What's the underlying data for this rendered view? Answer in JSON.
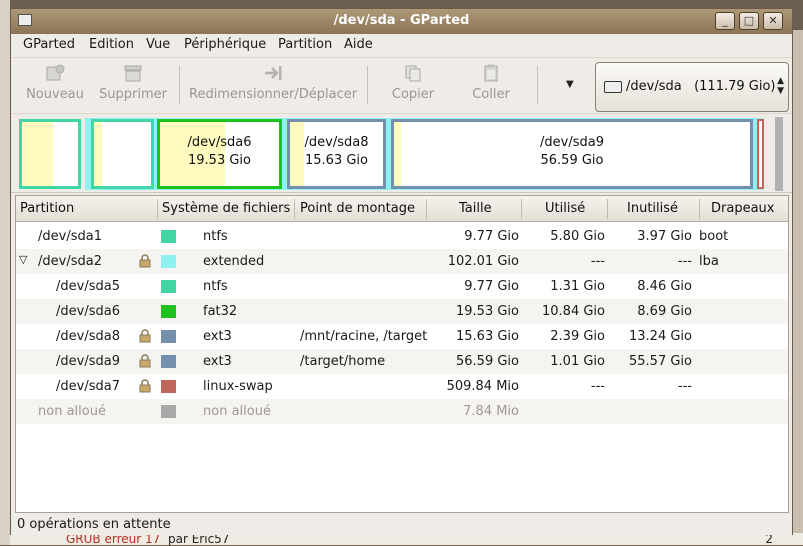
{
  "window": {
    "title": "/dev/sda - GParted",
    "min_label": "_",
    "max_label": "□",
    "close_label": "✕"
  },
  "menu": [
    "GParted",
    "Edition",
    "Vue",
    "Périphérique",
    "Partition",
    "Aide"
  ],
  "toolbar": {
    "new": "Nouveau",
    "delete": "Supprimer",
    "resize": "Redimensionner/Déplacer",
    "copy": "Copier",
    "paste": "Coller",
    "device": "/dev/sda   (111.79 Gio)"
  },
  "map": {
    "sda6": {
      "name": "/dev/sda6",
      "size": "19.53 Gio"
    },
    "sda8": {
      "name": "/dev/sda8",
      "size": "15.63 Gio"
    },
    "sda9": {
      "name": "/dev/sda9",
      "size": "56.59 Gio"
    }
  },
  "table": {
    "headers": [
      "Partition",
      "Système de fichiers",
      "Point de montage",
      "Taille",
      "Utilisé",
      "Inutilisé",
      "Drapeaux"
    ],
    "rows": [
      {
        "partition": "/dev/sda1",
        "locked": false,
        "color": "#42d6a4",
        "fs": "ntfs",
        "mount": "",
        "size": "9.77 Gio",
        "used": "5.80 Gio",
        "unused": "3.97 Gio",
        "flags": "boot"
      },
      {
        "partition": "/dev/sda2",
        "locked": true,
        "color": "#8ef2f2",
        "fs": "extended",
        "mount": "",
        "size": "102.01 Gio",
        "used": "---",
        "unused": "---",
        "flags": "lba"
      },
      {
        "partition": "/dev/sda5",
        "locked": false,
        "color": "#42d6a4",
        "fs": "ntfs",
        "mount": "",
        "size": "9.77 Gio",
        "used": "1.31 Gio",
        "unused": "8.46 Gio",
        "flags": ""
      },
      {
        "partition": "/dev/sda6",
        "locked": false,
        "color": "#1fc11f",
        "fs": "fat32",
        "mount": "",
        "size": "19.53 Gio",
        "used": "10.84 Gio",
        "unused": "8.69 Gio",
        "flags": ""
      },
      {
        "partition": "/dev/sda8",
        "locked": true,
        "color": "#7590ad",
        "fs": "ext3",
        "mount": "/mnt/racine, /target",
        "size": "15.63 Gio",
        "used": "2.39 Gio",
        "unused": "13.24 Gio",
        "flags": ""
      },
      {
        "partition": "/dev/sda9",
        "locked": true,
        "color": "#7590ad",
        "fs": "ext3",
        "mount": "/target/home",
        "size": "56.59 Gio",
        "used": "1.01 Gio",
        "unused": "55.57 Gio",
        "flags": ""
      },
      {
        "partition": "/dev/sda7",
        "locked": true,
        "color": "#c1665a",
        "fs": "linux-swap",
        "mount": "",
        "size": "509.84 Mio",
        "used": "---",
        "unused": "---",
        "flags": ""
      },
      {
        "partition": "non alloué",
        "locked": false,
        "color": "#a9a9a9",
        "fs": "non alloué",
        "mount": "",
        "size": "7.84 Mio",
        "used": "",
        "unused": "",
        "flags": ""
      }
    ]
  },
  "status": "0 opérations en attente",
  "background": {
    "link": "GRUB erreur 17",
    "by": "par Eric57",
    "count": "2"
  }
}
